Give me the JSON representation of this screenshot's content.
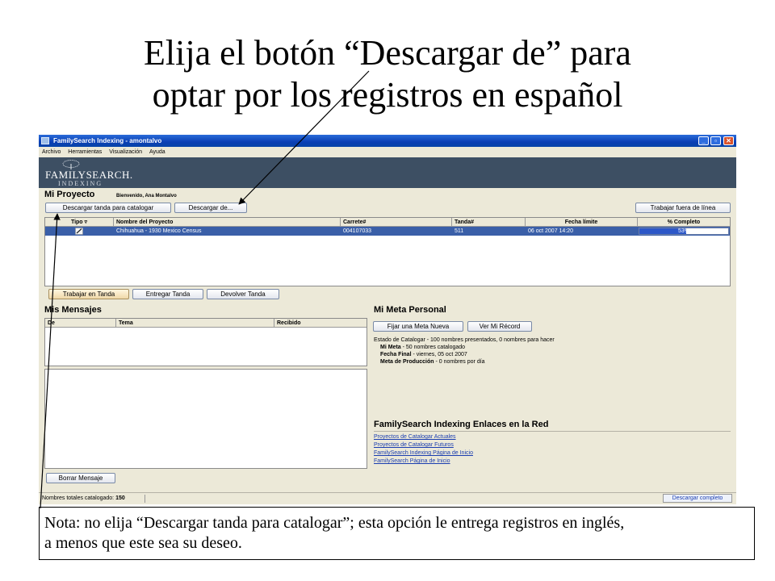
{
  "slide": {
    "title_line1": "Elija el botón “Descargar de” para",
    "title_line2": "optar por los registros en español",
    "note_line1": "Nota: no elija “Descargar tanda para catalogar”; esta opción le entrega registros en inglés,",
    "note_line2": "a menos que este sea su deseo."
  },
  "window": {
    "title": "FamilySearch Indexing - amontalvo",
    "minimize": "_",
    "maximize": "▫",
    "close": "✕"
  },
  "menu": [
    "Archivo",
    "Herramientas",
    "Visualización",
    "Ayuda"
  ],
  "banner": {
    "logo": "FAMILYSEARCH.",
    "logo_sub": "INDEXING"
  },
  "project": {
    "title": "Mi Proyecto",
    "welcome": "Bienvenido, Ana Montalvo",
    "download_batch": "Descargar tanda para catalogar",
    "download_from": "Descargar de...",
    "work_offline": "Trabajar fuera de línea",
    "columns": [
      "Tipo ▿",
      "Nombre del Proyecto",
      "Carrete#",
      "Tanda#",
      "Fecha límite",
      "% Completo"
    ],
    "row": {
      "name": "Chihuahua - 1930 Mexico Census",
      "reel": "004107033",
      "batch": "511",
      "due": "06 oct 2007 14:20",
      "complete_text": "53%",
      "complete": 0.53
    },
    "work_batch": "Trabajar en Tanda",
    "submit_batch": "Entregar Tanda",
    "return_batch": "Devolver Tanda"
  },
  "messages": {
    "title": "Mis Mensajes",
    "columns": [
      "De",
      "Tema",
      "Recibido"
    ],
    "delete": "Borrar Mensaje"
  },
  "goal": {
    "title": "Mi Meta Personal",
    "set_goal": "Fijar una Meta Nueva",
    "record": "Ver Mi Récord",
    "status": "Estado de Catalogar - 100 nombres presentados, 0 nombres para hacer",
    "meta_label": "Mi Meta",
    "meta_value": " - 50 nombres catalogado",
    "final_label": "Fecha Final",
    "final_value": " - viernes, 05 oct 2007",
    "prod_label": "Meta de Producción",
    "prod_value": " - 0 nombres por día"
  },
  "links": {
    "title": "FamilySearch Indexing Enlaces en la Red",
    "items": [
      "Proyectos de Catalogar Actuales",
      "Proyectos de Catalogar Futuros",
      "FamilySearch Indexing Página de Inicio",
      "FamilySearch Página de Inicio"
    ]
  },
  "status": {
    "total_label": "Nombres totales catalogado:",
    "total_value": "150",
    "download": "Descargar completo"
  },
  "colors": {
    "titlebar": "#0a3fb4",
    "banner": "#3d4f63",
    "selected_row": "#3a5fa8",
    "link": "#1a3db0"
  },
  "icons": [
    "app-icon",
    "tree-logo-icon",
    "edit-pencil-icon",
    "minimize-icon",
    "maximize-icon",
    "close-icon"
  ]
}
